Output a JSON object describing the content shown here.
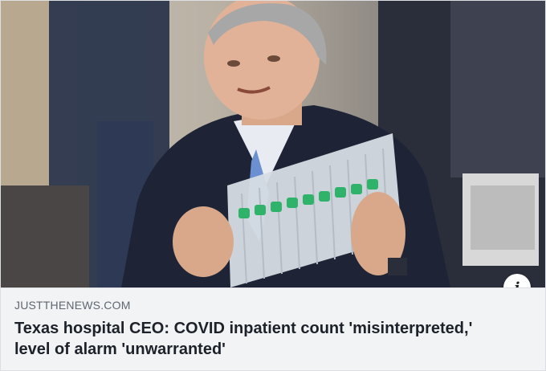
{
  "link_preview": {
    "domain": "JUSTTHENEWS.COM",
    "headline": "Texas hospital CEO: COVID inpatient count 'misinterpreted,' level of alarm 'unwarranted'",
    "info_icon": "info-icon"
  },
  "colors": {
    "card_bg": "#f2f3f5",
    "domain_text": "#606770",
    "headline_text": "#1d2129",
    "cap_green": "#2fb36a",
    "suit": "#1e2436"
  }
}
